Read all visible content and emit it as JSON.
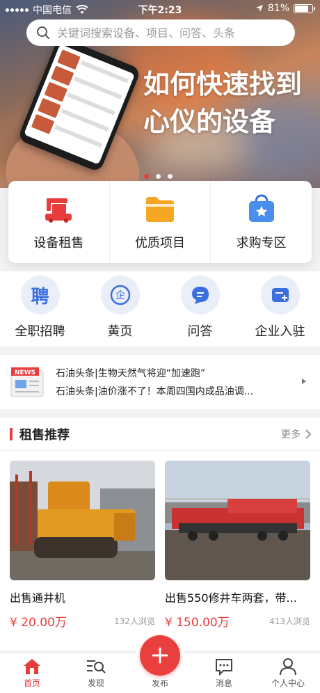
{
  "status_bar": {
    "carrier": "中国电信",
    "time": "下午2:23",
    "battery": "81%",
    "battery_level": 0.81
  },
  "search": {
    "placeholder": "关键词搜索设备、项目、问答、头条"
  },
  "banner": {
    "title_line1": "如何快速找到",
    "title_line2": "心仪的设备",
    "slide_count": 3,
    "active_slide": 1
  },
  "categories": [
    {
      "label": "设备租售",
      "icon": "excavator-icon"
    },
    {
      "label": "优质项目",
      "icon": "folder-icon"
    },
    {
      "label": "求购专区",
      "icon": "shopping-bag-icon"
    }
  ],
  "quick_links": [
    {
      "label": "全职招聘",
      "icon": "recruit-icon",
      "glyph": "聘"
    },
    {
      "label": "黄页",
      "icon": "yellow-pages-icon",
      "glyph": "企"
    },
    {
      "label": "问答",
      "icon": "chat-bubble-icon"
    },
    {
      "label": "企业入驻",
      "icon": "company-join-icon"
    }
  ],
  "news": {
    "icon_label": "NEWS",
    "items": [
      "石油头条|生物天然气将迎“加速跑”",
      "石油头条|油价涨不了！本周四国内成品油调..."
    ]
  },
  "recommend": {
    "title": "租售推荐",
    "more": "更多",
    "items": [
      {
        "title": "出售通井机",
        "price": "¥ 20.00万",
        "views": "132人浏览"
      },
      {
        "title": "出售550修井车两套，带...",
        "price": "¥ 150.00万",
        "views": "413人浏览"
      }
    ]
  },
  "tabbar": {
    "tabs": [
      {
        "label": "首页",
        "active": true
      },
      {
        "label": "发现"
      },
      {
        "label": "发布"
      },
      {
        "label": "消息"
      },
      {
        "label": "个人中心"
      }
    ]
  },
  "colors": {
    "accent": "#e83d3d",
    "icon_blue": "#3b6fe0",
    "orange": "#f5a623"
  }
}
